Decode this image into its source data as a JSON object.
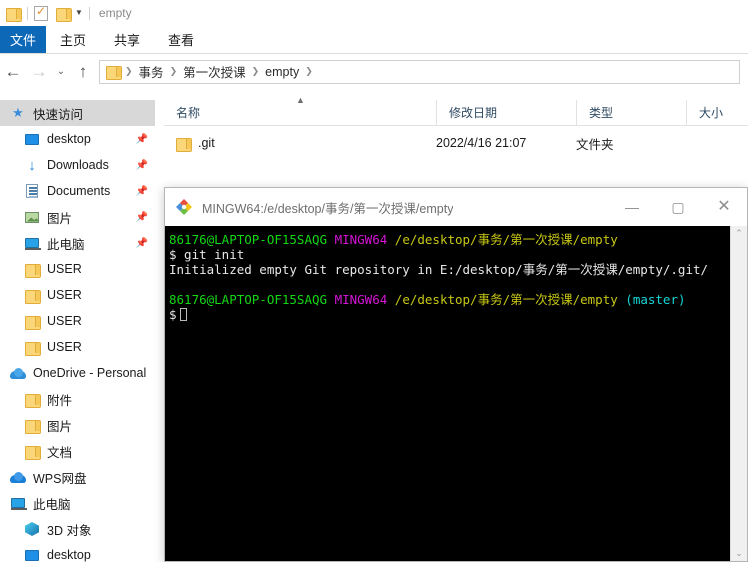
{
  "explorer": {
    "quick_access_toolbar": {
      "folder_icon": "folder-icon",
      "properties_icon": "properties-checkmark-icon",
      "new_folder_icon": "new-folder-icon",
      "dropdown_icon": "chevron-down-icon",
      "title": "empty"
    },
    "ribbon": {
      "file_tab": "文件",
      "tabs": [
        "主页",
        "共享",
        "查看"
      ]
    },
    "navigation": {
      "back_icon": "back-arrow-icon",
      "forward_icon": "forward-arrow-icon",
      "recent_icon": "chevron-down-icon",
      "up_icon": "up-arrow-icon",
      "breadcrumbs": [
        "事务",
        "第一次授课",
        "empty"
      ]
    },
    "columns": [
      {
        "label": "名称",
        "sorted": true
      },
      {
        "label": "修改日期",
        "sorted": false
      },
      {
        "label": "类型",
        "sorted": false
      },
      {
        "label": "大小",
        "sorted": false
      }
    ],
    "sort_caret": "▲",
    "files": [
      {
        "name": ".git",
        "date": "2022/4/16 21:07",
        "type": "文件夹",
        "size": "",
        "icon": "folder-icon"
      }
    ],
    "sidebar": [
      {
        "label": "快速访问",
        "icon": "star-pin-icon",
        "level": 0,
        "selected": true,
        "pinned": false
      },
      {
        "label": "desktop",
        "icon": "monitor-icon",
        "level": 1,
        "selected": false,
        "pinned": true
      },
      {
        "label": "Downloads",
        "icon": "download-arrow-icon",
        "level": 1,
        "selected": false,
        "pinned": true
      },
      {
        "label": "Documents",
        "icon": "document-icon",
        "level": 1,
        "selected": false,
        "pinned": true
      },
      {
        "label": "图片",
        "icon": "picture-icon",
        "level": 1,
        "selected": false,
        "pinned": true
      },
      {
        "label": "此电脑",
        "icon": "computer-icon",
        "level": 1,
        "selected": false,
        "pinned": true
      },
      {
        "label": "USER",
        "icon": "folder-icon",
        "level": 1,
        "selected": false,
        "pinned": false
      },
      {
        "label": "USER",
        "icon": "folder-icon",
        "level": 1,
        "selected": false,
        "pinned": false
      },
      {
        "label": "USER",
        "icon": "folder-icon",
        "level": 1,
        "selected": false,
        "pinned": false
      },
      {
        "label": "USER",
        "icon": "folder-icon",
        "level": 1,
        "selected": false,
        "pinned": false
      },
      {
        "label": "OneDrive - Personal",
        "icon": "onedrive-cloud-icon",
        "level": 0,
        "selected": false,
        "pinned": false
      },
      {
        "label": "附件",
        "icon": "folder-icon",
        "level": 1,
        "selected": false,
        "pinned": false
      },
      {
        "label": "图片",
        "icon": "folder-icon",
        "level": 1,
        "selected": false,
        "pinned": false
      },
      {
        "label": "文档",
        "icon": "folder-icon",
        "level": 1,
        "selected": false,
        "pinned": false
      },
      {
        "label": "WPS网盘",
        "icon": "wps-cloud-icon",
        "level": 0,
        "selected": false,
        "pinned": false
      },
      {
        "label": "此电脑",
        "icon": "computer-icon",
        "level": 0,
        "selected": false,
        "pinned": false
      },
      {
        "label": "3D 对象",
        "icon": "3d-object-icon",
        "level": 1,
        "selected": false,
        "pinned": false
      },
      {
        "label": "desktop",
        "icon": "monitor-icon",
        "level": 1,
        "selected": false,
        "pinned": false
      }
    ]
  },
  "terminal": {
    "title": "MINGW64:/e/desktop/事务/第一次授课/empty",
    "app_icon": "git-bash-icon",
    "window_controls": {
      "minimize": "—",
      "maximize": "▢",
      "close": "✕"
    },
    "scrollbar": {
      "up_arrow": "⌃",
      "down_arrow": "⌄"
    },
    "colors": {
      "background": "#000000",
      "user_host": "#14d814",
      "shell": "#d614d6",
      "path": "#c8c814",
      "branch": "#14d6d6",
      "text": "#e8e8e8"
    },
    "lines": [
      {
        "type": "prompt",
        "user_host": "86176@LAPTOP-OF15SAQG",
        "shell": "MINGW64",
        "path": "/e/desktop/事务/第一次授课/empty",
        "branch": ""
      },
      {
        "type": "command",
        "text": "$ git init"
      },
      {
        "type": "output",
        "text": "Initialized empty Git repository in E:/desktop/事务/第一次授课/empty/.git/"
      },
      {
        "type": "blank",
        "text": ""
      },
      {
        "type": "prompt",
        "user_host": "86176@LAPTOP-OF15SAQG",
        "shell": "MINGW64",
        "path": "/e/desktop/事务/第一次授课/empty",
        "branch": "(master)"
      },
      {
        "type": "command_cursor",
        "text": "$"
      }
    ]
  }
}
